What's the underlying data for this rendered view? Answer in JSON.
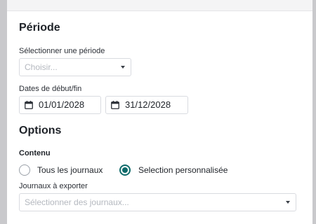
{
  "periode": {
    "title": "Période",
    "select_label": "Sélectionner une période",
    "select_placeholder": "Choisir...",
    "dates_label": "Dates de début/fin",
    "start_date": "01/01/2028",
    "end_date": "31/12/2028"
  },
  "options": {
    "title": "Options",
    "content_label": "Contenu",
    "radio_all": "Tous les journaux",
    "radio_custom": "Selection personnalisée",
    "selected": "custom",
    "journals_label": "Journaux à exporter",
    "journals_placeholder": "Sélectionner des journaux..."
  },
  "colors": {
    "accent": "#0f6b6b"
  }
}
